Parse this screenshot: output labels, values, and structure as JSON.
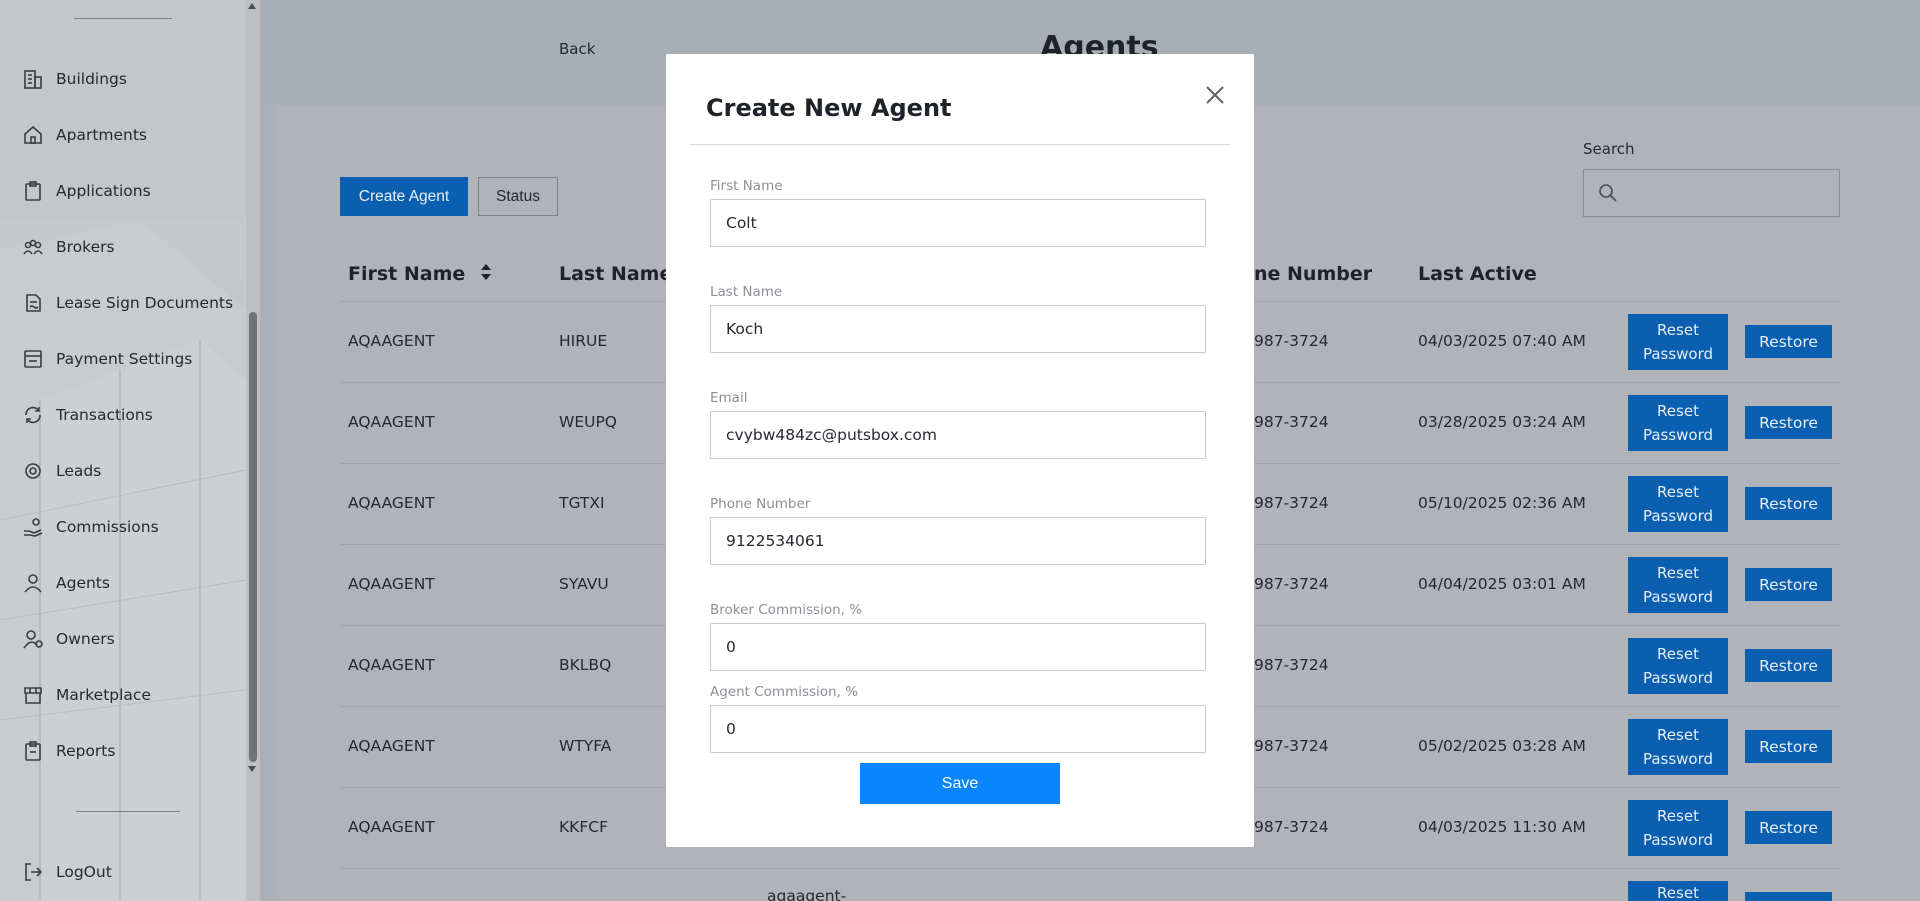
{
  "sidebar": {
    "items": [
      {
        "label": "Buildings",
        "icon": "buildings-icon"
      },
      {
        "label": "Apartments",
        "icon": "house-icon"
      },
      {
        "label": "Applications",
        "icon": "clipboard-icon"
      },
      {
        "label": "Brokers",
        "icon": "people-group-icon"
      },
      {
        "label": "Lease Sign Documents",
        "icon": "document-sign-icon"
      },
      {
        "label": "Payment Settings",
        "icon": "payment-settings-icon"
      },
      {
        "label": "Transactions",
        "icon": "transactions-icon"
      },
      {
        "label": "Leads",
        "icon": "leads-icon"
      },
      {
        "label": "Commissions",
        "icon": "hand-coin-icon"
      },
      {
        "label": "Agents",
        "icon": "agent-icon"
      },
      {
        "label": "Owners",
        "icon": "owner-icon"
      },
      {
        "label": "Marketplace",
        "icon": "storefront-icon"
      },
      {
        "label": "Reports",
        "icon": "report-icon"
      }
    ],
    "logout_label": "LogOut"
  },
  "header": {
    "back_label": "Back",
    "page_title": "Agents"
  },
  "toolbar": {
    "create_label": "Create Agent",
    "status_label": "Status",
    "search_label": "Search",
    "search_placeholder": ""
  },
  "table": {
    "columns": {
      "first_name": "First Name",
      "last_name": "Last Name",
      "phone_partial": "ne Number",
      "last_active": "Last Active"
    },
    "rows": [
      {
        "first": "AQAAGENT",
        "last": "HIRUE",
        "phone": "987-3724",
        "active": "04/03/2025 07:40 AM"
      },
      {
        "first": "AQAAGENT",
        "last": "WEUPQ",
        "phone": "987-3724",
        "active": "03/28/2025 03:24 AM"
      },
      {
        "first": "AQAAGENT",
        "last": "TGTXI",
        "phone": "987-3724",
        "active": "05/10/2025 02:36 AM"
      },
      {
        "first": "AQAAGENT",
        "last": "SYAVU",
        "phone": "987-3724",
        "active": "04/04/2025 03:01 AM"
      },
      {
        "first": "AQAAGENT",
        "last": "BKLBQ",
        "phone": "987-3724",
        "active": ""
      },
      {
        "first": "AQAAGENT",
        "last": "WTYFA",
        "phone": "987-3724",
        "active": "05/02/2025 03:28 AM"
      },
      {
        "first": "AQAAGENT",
        "last": "KKFCF",
        "phone": "987-3724",
        "active": "04/03/2025 11:30 AM"
      }
    ],
    "partial_row_email": "aqaagent-",
    "reset_label_line1": "Reset",
    "reset_label_line2": "Password",
    "restore_label": "Restore"
  },
  "modal": {
    "title": "Create New Agent",
    "fields": {
      "first_name": {
        "label": "First Name",
        "value": "Colt"
      },
      "last_name": {
        "label": "Last Name",
        "value": "Koch"
      },
      "email": {
        "label": "Email",
        "value": "cvybw484zc@putsbox.com"
      },
      "phone": {
        "label": "Phone Number",
        "value": "9122534061"
      },
      "broker_commission": {
        "label": "Broker Commission, %",
        "value": "0"
      },
      "agent_commission": {
        "label": "Agent Commission, %",
        "value": "0"
      }
    },
    "save_label": "Save"
  },
  "colors": {
    "primary_button": "#0a5fb0",
    "save_button": "#0a84ff",
    "overlay_dim": "#aab0b8"
  }
}
